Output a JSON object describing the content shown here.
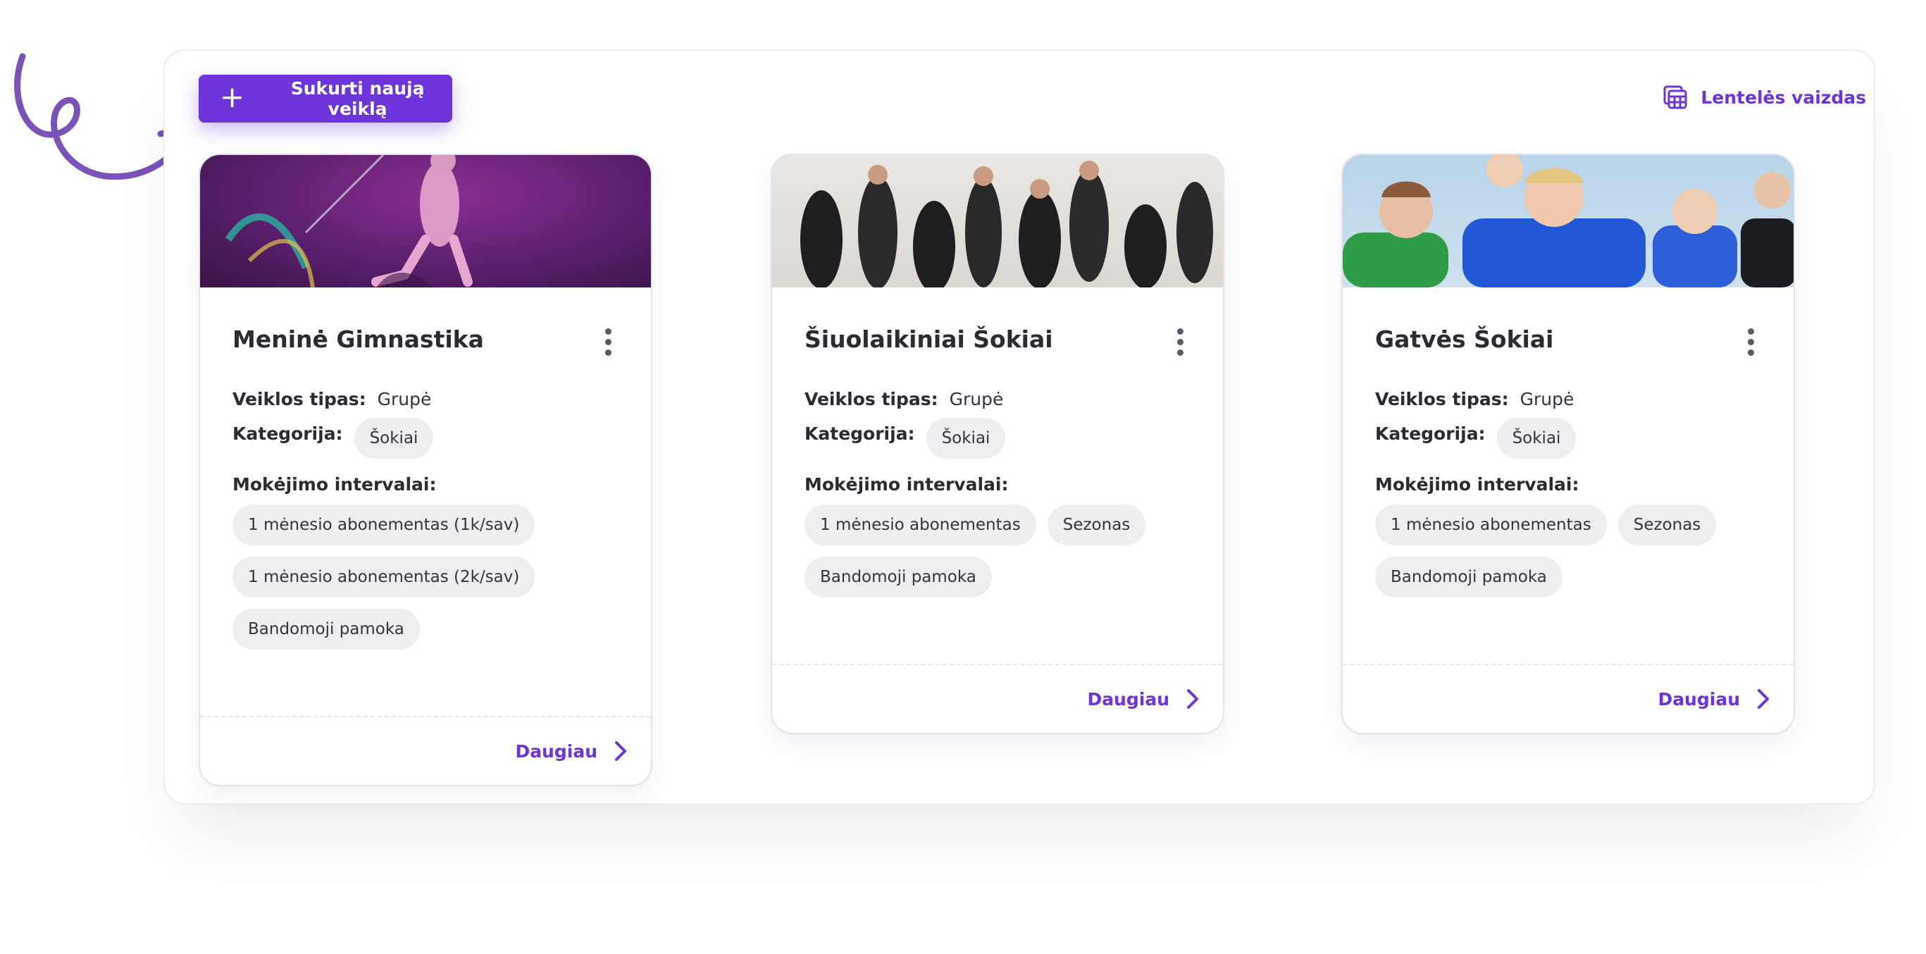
{
  "toolbar": {
    "create_label": "Sukurti naują veiklą",
    "table_view_label": "Lentelės vaizdas"
  },
  "colors": {
    "accent": "#6d34d9",
    "chip_bg": "#eeeef1",
    "text": "#2b2b33"
  },
  "icons": {
    "create": "plus-icon",
    "table_view": "table-icon",
    "card_menu": "more-vertical-icon",
    "more": "chevron-right-icon",
    "decoration": "curly-arrow-icon"
  },
  "cards": [
    {
      "title": "Meninė Gimnastika",
      "image": "rhythmic-gymnast-ribbon",
      "type_label": "Veiklos tipas:",
      "type_value": "Grupė",
      "category_label": "Kategorija:",
      "category": "Šokiai",
      "payment_label": "Mokėjimo intervalai:",
      "payments": [
        "1 mėnesio abonementas (1k/sav)",
        "1 mėnesio abonementas (2k/sav)",
        "Bandomoji pamoka"
      ],
      "more_label": "Daugiau"
    },
    {
      "title": "Šiuolaikiniai Šokiai",
      "image": "contemporary-dancers",
      "type_label": "Veiklos tipas:",
      "type_value": "Grupė",
      "category_label": "Kategorija:",
      "category": "Šokiai",
      "payment_label": "Mokėjimo intervalai:",
      "payments": [
        "1 mėnesio abonementas",
        "Sezonas",
        "Bandomoji pamoka"
      ],
      "more_label": "Daugiau"
    },
    {
      "title": "Gatvės Šokiai",
      "image": "street-dance-kids",
      "type_label": "Veiklos tipas:",
      "type_value": "Grupė",
      "category_label": "Kategorija:",
      "category": "Šokiai",
      "payment_label": "Mokėjimo intervalai:",
      "payments": [
        "1 mėnesio abonementas",
        "Sezonas",
        "Bandomoji pamoka"
      ],
      "more_label": "Daugiau"
    }
  ]
}
